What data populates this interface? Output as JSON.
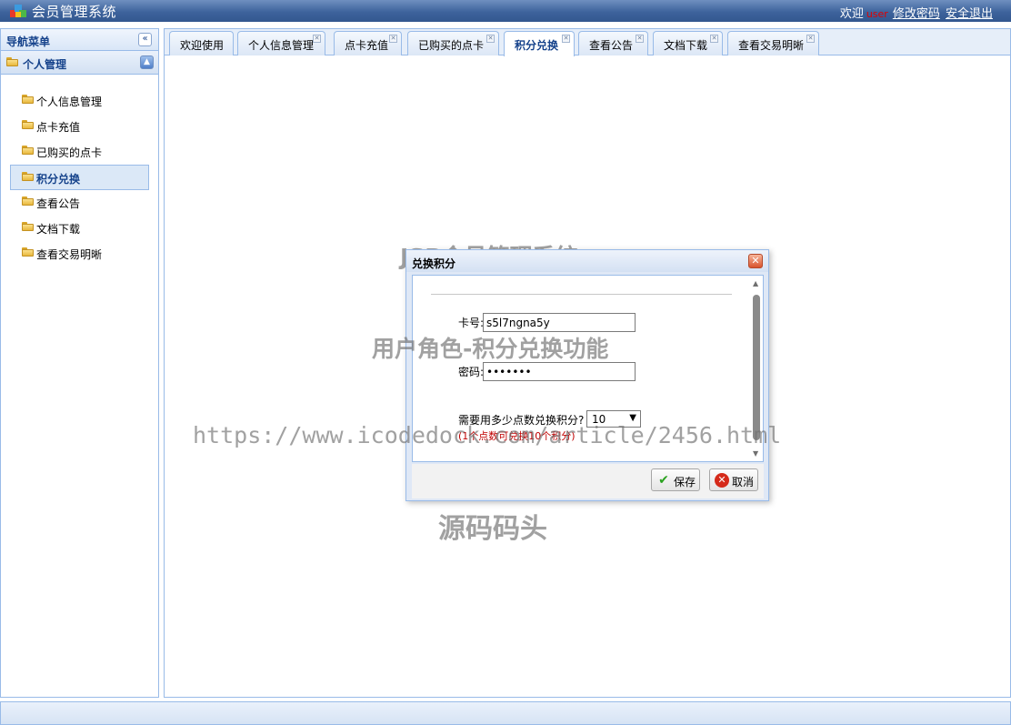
{
  "header": {
    "title": "会员管理系统",
    "welcome": "欢迎",
    "user": "user",
    "change_password": "修改密码",
    "logout": "安全退出"
  },
  "nav": {
    "title": "导航菜单",
    "group": "个人管理",
    "items": [
      {
        "label": "个人信息管理"
      },
      {
        "label": "点卡充值"
      },
      {
        "label": "已购买的点卡"
      },
      {
        "label": "积分兑换"
      },
      {
        "label": "查看公告"
      },
      {
        "label": "文档下载"
      },
      {
        "label": "查看交易明晰"
      }
    ],
    "active_item": "积分兑换"
  },
  "tabs": [
    {
      "label": "欢迎使用"
    },
    {
      "label": "个人信息管理"
    },
    {
      "label": "点卡充值"
    },
    {
      "label": "已购买的点卡"
    },
    {
      "label": "积分兑换"
    },
    {
      "label": "查看公告"
    },
    {
      "label": "文档下载"
    },
    {
      "label": "查看交易明晰"
    }
  ],
  "active_tab": "积分兑换",
  "dialog": {
    "title": "兑换积分",
    "card_label": "卡号:",
    "card_value": "s5l7ngna5y",
    "password_label": "密码:",
    "password_value": "1234567",
    "points_label": "需要用多少点数兑换积分?",
    "points_value": "10",
    "hint": "(1个点数可兑换10个积分)",
    "save_label": "保存",
    "cancel_label": "取消"
  },
  "watermarks": {
    "line1": "JSP会员管理系统",
    "line2": "用户角色-积分兑换功能",
    "line3": "https://www.icodedock.com/article/2456.html",
    "line4": "源码码头"
  }
}
